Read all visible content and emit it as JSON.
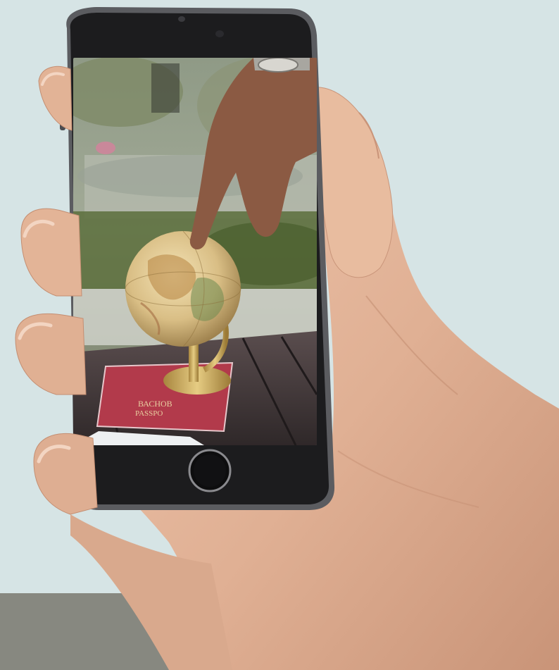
{
  "scene": {
    "background_color": "#d6e4e5",
    "floor_color": "#878880",
    "floor_edge_color": "#a8aaa3",
    "skin_color": "#e3b79c",
    "skin_shadow_color": "#c78f72",
    "phone_body_color": "#1c1c1e",
    "phone_bezel_color": "#5b5c60"
  },
  "phone_screen": {
    "passport_text_line1": "ВАСНОВ",
    "passport_text_line2": "PASSPO"
  },
  "icons": {
    "home_button": "home-button-icon",
    "front_camera": "front-camera-icon",
    "speaker": "earpiece-speaker-icon"
  }
}
